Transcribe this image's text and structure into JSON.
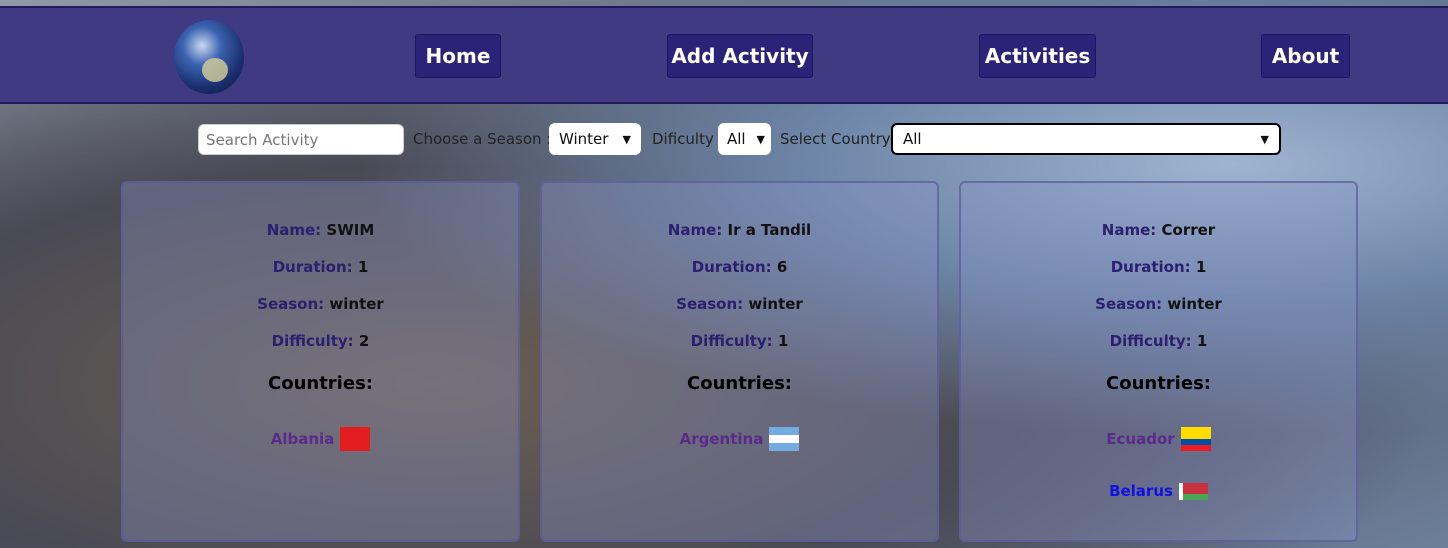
{
  "nav": {
    "items": [
      "Home",
      "Add Activity",
      "Activities",
      "About"
    ]
  },
  "filters": {
    "search_placeholder": "Search Activity",
    "season_label": "Choose a Season :",
    "season_value": "Winter",
    "difficulty_label": "Dificulty",
    "difficulty_value": "All",
    "country_label": "Select Country",
    "country_value": "All"
  },
  "labels": {
    "name": "Name:",
    "duration": "Duration:",
    "season": "Season:",
    "difficulty": "Difficulty:",
    "countries": "Countries:"
  },
  "cards": [
    {
      "name": "SWIM",
      "duration": "1",
      "season": "winter",
      "difficulty": "2",
      "countries": [
        {
          "name": "Albania",
          "color": "#5a2a8a"
        }
      ]
    },
    {
      "name": "Ir a Tandil",
      "duration": "6",
      "season": "winter",
      "difficulty": "1",
      "countries": [
        {
          "name": "Argentina",
          "color": "#5a2a8a"
        }
      ]
    },
    {
      "name": "Correr",
      "duration": "1",
      "season": "winter",
      "difficulty": "1",
      "countries": [
        {
          "name": "Ecuador",
          "color": "#5a2a8a"
        },
        {
          "name": "Belarus",
          "color": "#1010e0"
        }
      ]
    }
  ]
}
